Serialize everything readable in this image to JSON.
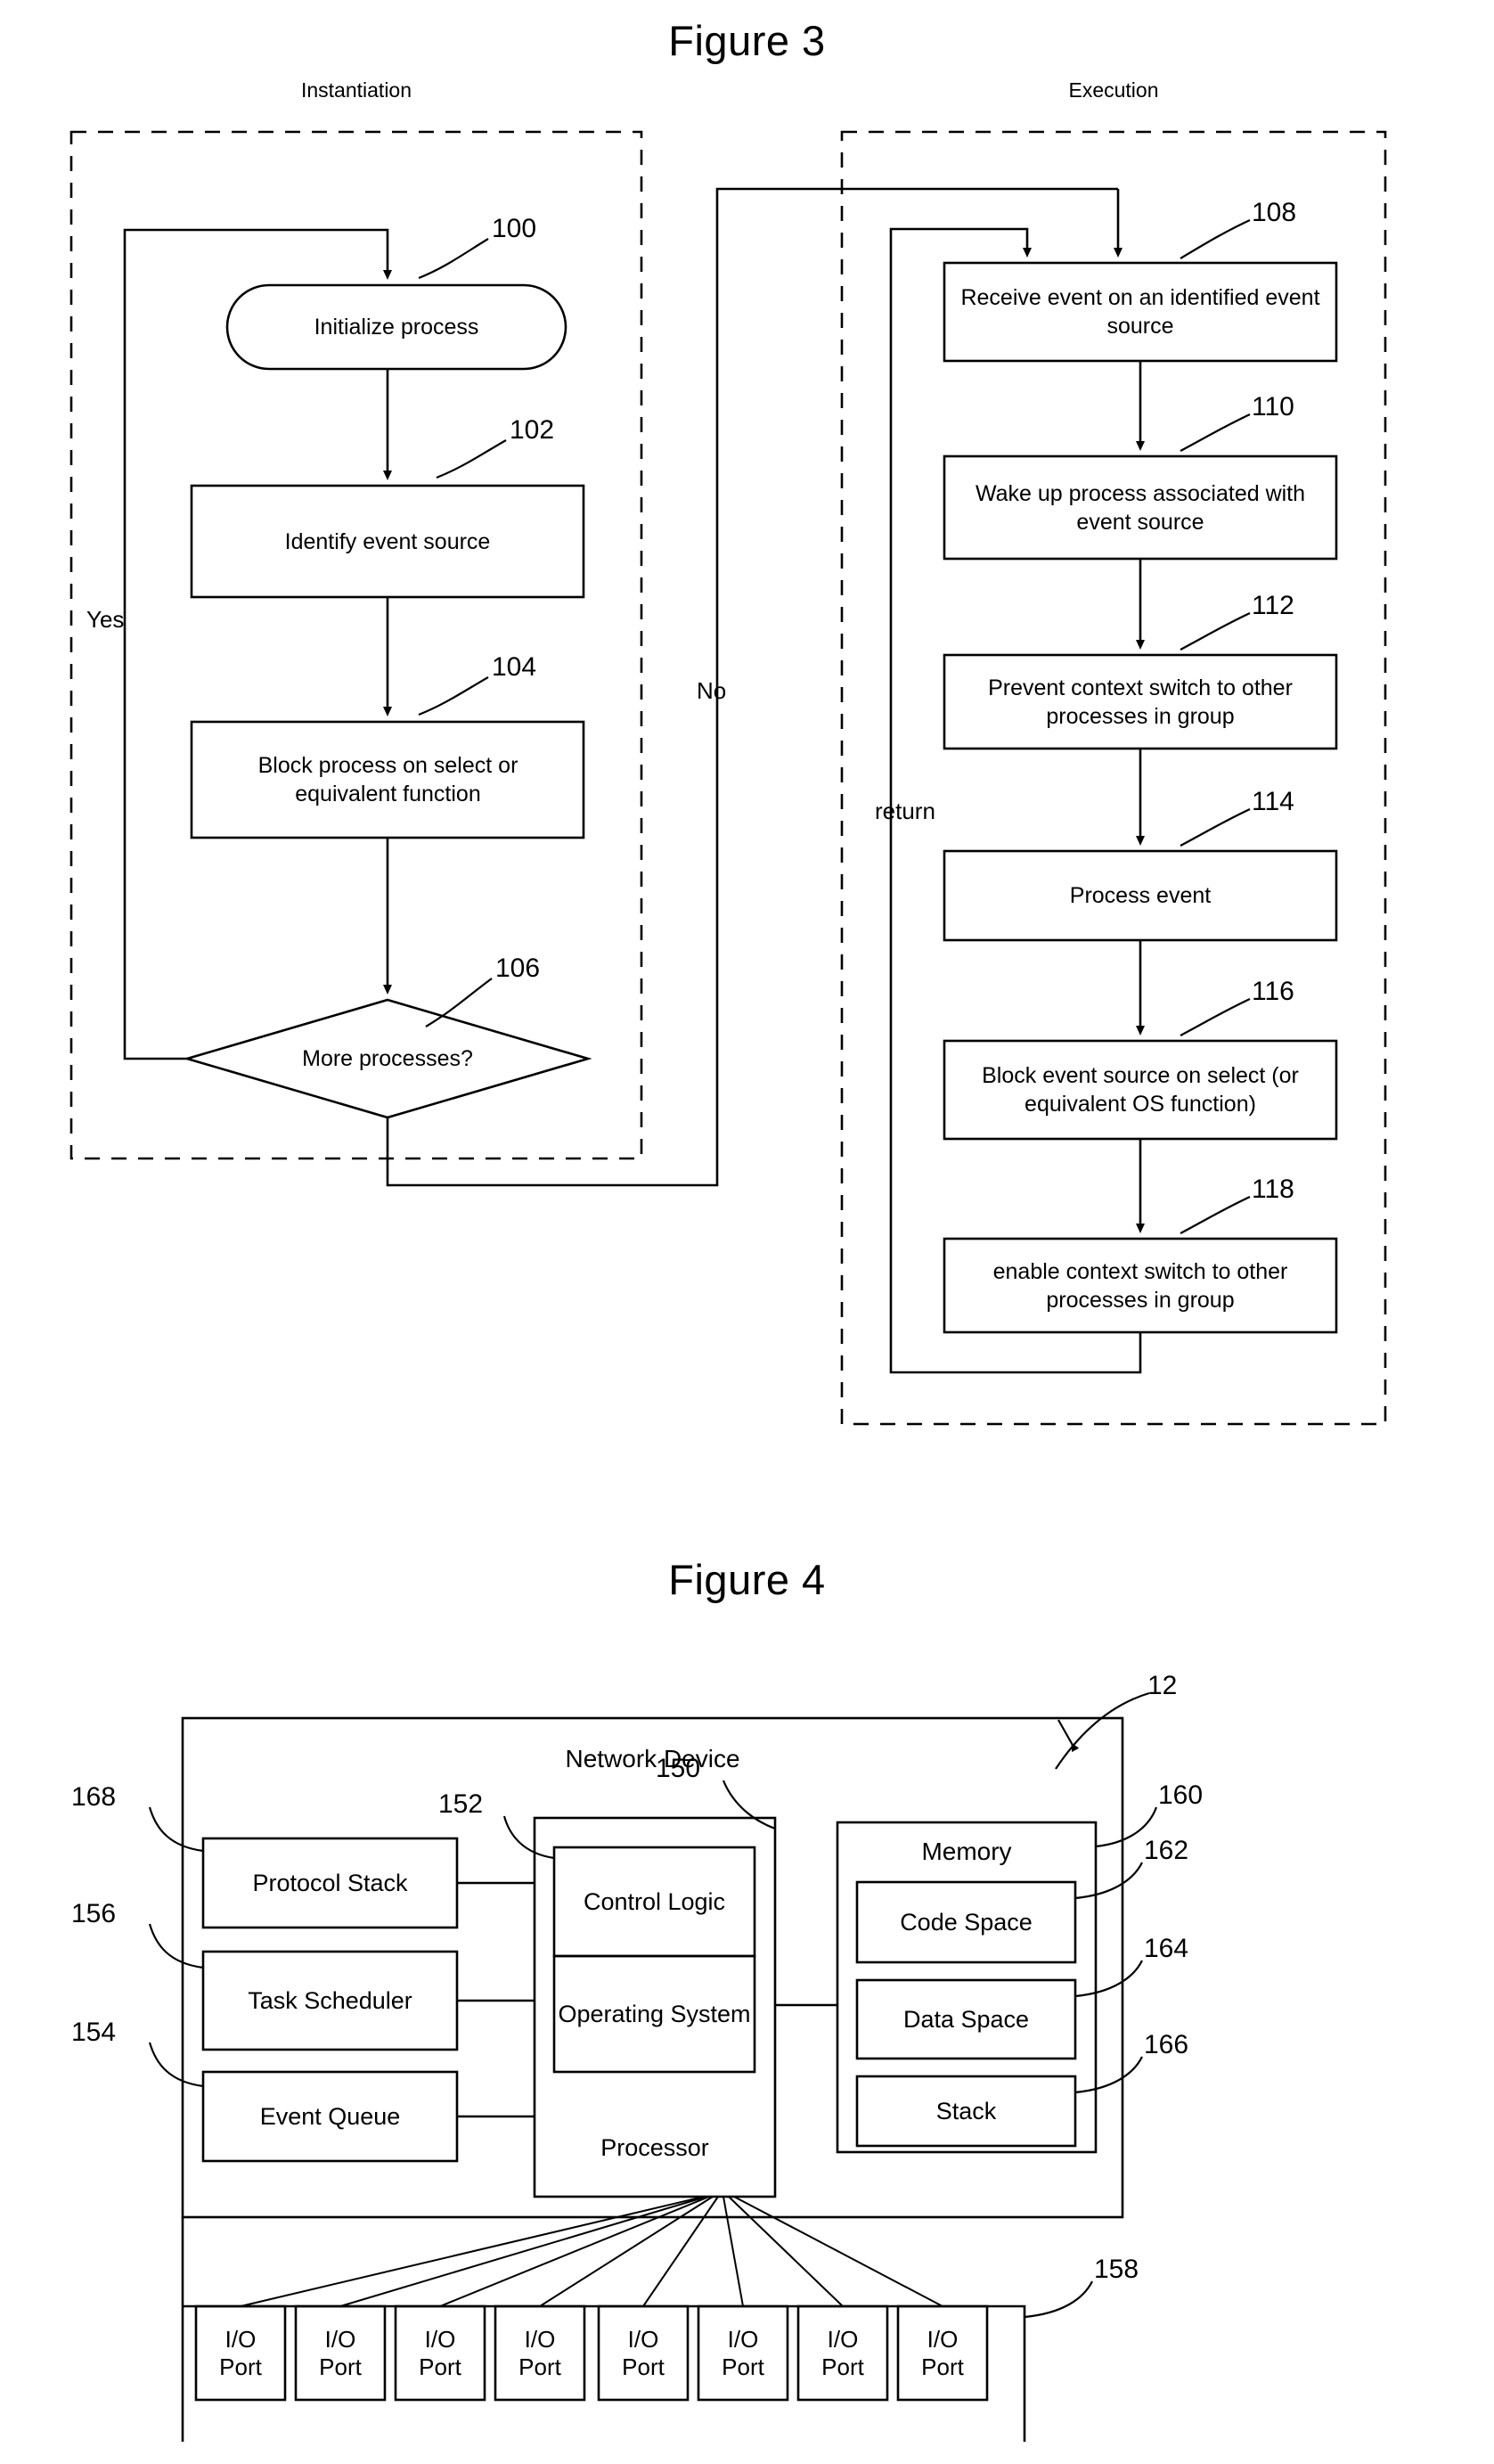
{
  "figures": [
    {
      "title": "Figure 3",
      "panels": [
        {
          "label": "Instantiation"
        },
        {
          "label": "Execution"
        }
      ],
      "instantiation_steps": [
        {
          "ref": "100",
          "text": "Initialize process",
          "shape": "stadium"
        },
        {
          "ref": "102",
          "text": "Identify event source",
          "shape": "rect"
        },
        {
          "ref": "104",
          "text": "Block process on select or equivalent function",
          "shape": "rect"
        },
        {
          "ref": "106",
          "text": "More processes?",
          "shape": "diamond"
        }
      ],
      "execution_steps": [
        {
          "ref": "108",
          "text": "Receive event on an identified event source",
          "shape": "rect"
        },
        {
          "ref": "110",
          "text": "Wake up process associated with event source",
          "shape": "rect"
        },
        {
          "ref": "112",
          "text": "Prevent context switch to other processes in group",
          "shape": "rect"
        },
        {
          "ref": "114",
          "text": "Process event",
          "shape": "rect"
        },
        {
          "ref": "116",
          "text": "Block event source on select (or equivalent OS function)",
          "shape": "rect"
        },
        {
          "ref": "118",
          "text": "enable context switch to other processes in group",
          "shape": "rect"
        }
      ],
      "edge_labels": [
        {
          "text": "Yes"
        },
        {
          "text": "No"
        },
        {
          "text": "return"
        }
      ]
    },
    {
      "title": "Figure 4",
      "device_ref": "12",
      "device_label": "Network Device",
      "left_blocks": [
        {
          "ref": "168",
          "text": "Protocol Stack"
        },
        {
          "ref": "156",
          "text": "Task Scheduler"
        },
        {
          "ref": "154",
          "text": "Event Queue"
        }
      ],
      "processor": {
        "ref": "150",
        "label": "Processor",
        "inner_ref": "152",
        "inner_blocks": [
          {
            "text": "Control Logic"
          },
          {
            "text": "Operating System"
          }
        ]
      },
      "memory": {
        "ref": "160",
        "label": "Memory",
        "blocks": [
          {
            "ref": "162",
            "text": "Code Space"
          },
          {
            "ref": "164",
            "text": "Data Space"
          },
          {
            "ref": "166",
            "text": "Stack"
          }
        ]
      },
      "io": {
        "ref": "158",
        "port_line1": "I/O",
        "port_line2": "Port",
        "count": 8
      }
    }
  ],
  "colors": {
    "stroke": "#000000",
    "background": "#ffffff"
  }
}
